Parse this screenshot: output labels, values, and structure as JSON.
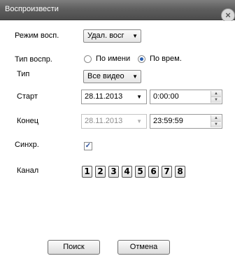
{
  "window": {
    "title": "Воспроизвести",
    "close_icon": "close-icon"
  },
  "form": {
    "mode": {
      "label": "Режим восп.",
      "value": "Удал. восг"
    },
    "playback_type": {
      "label": "Тип воспр.",
      "options": [
        {
          "label": "По имени",
          "checked": false
        },
        {
          "label": "По врем.",
          "checked": true
        }
      ]
    },
    "type": {
      "label": "Тип",
      "value": "Все видео"
    },
    "start": {
      "label": "Старт",
      "date": "28.11.2013",
      "time": "0:00:00"
    },
    "end": {
      "label": "Конец",
      "date": "28.11.2013",
      "time": "23:59:59"
    },
    "sync": {
      "label": "Синхр.",
      "checked": true
    },
    "channel": {
      "label": "Канал",
      "buttons": [
        "1",
        "2",
        "3",
        "4",
        "5",
        "6",
        "7",
        "8"
      ]
    }
  },
  "buttons": {
    "search": "Поиск",
    "cancel": "Отмена"
  }
}
